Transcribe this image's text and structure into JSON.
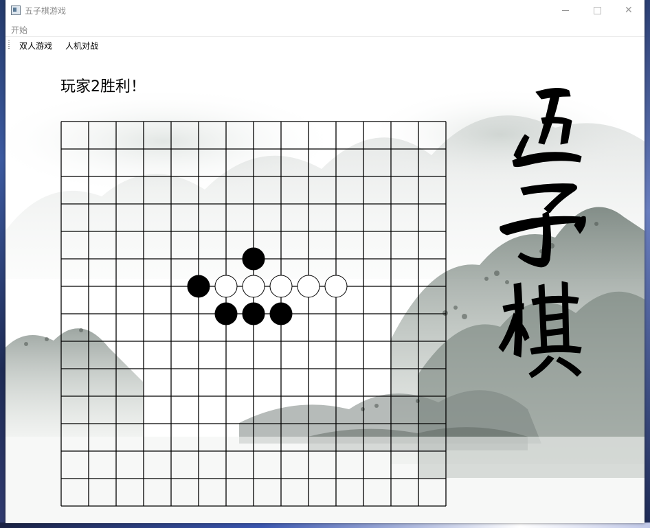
{
  "window": {
    "title": "五子棋游戏",
    "min_label": "",
    "max_label": "",
    "close_label": "✕"
  },
  "menu": {
    "items": [
      {
        "label": "开始"
      }
    ]
  },
  "toolbar": {
    "buttons": [
      {
        "label": "双人游戏"
      },
      {
        "label": "人机对战"
      }
    ]
  },
  "game": {
    "status": "玩家2胜利！",
    "board_size": 15,
    "stones": [
      {
        "row": 5,
        "col": 7,
        "color": "black"
      },
      {
        "row": 6,
        "col": 5,
        "color": "black"
      },
      {
        "row": 6,
        "col": 6,
        "color": "white"
      },
      {
        "row": 6,
        "col": 7,
        "color": "white"
      },
      {
        "row": 6,
        "col": 8,
        "color": "white"
      },
      {
        "row": 6,
        "col": 9,
        "color": "white"
      },
      {
        "row": 6,
        "col": 10,
        "color": "white"
      },
      {
        "row": 7,
        "col": 6,
        "color": "black"
      },
      {
        "row": 7,
        "col": 7,
        "color": "black"
      },
      {
        "row": 7,
        "col": 8,
        "color": "black"
      }
    ],
    "background_art": "ink-landscape",
    "title_art": "五子棋"
  },
  "colors": {
    "black_stone": "#000000",
    "white_stone": "#ffffff",
    "grid": "#000000"
  }
}
